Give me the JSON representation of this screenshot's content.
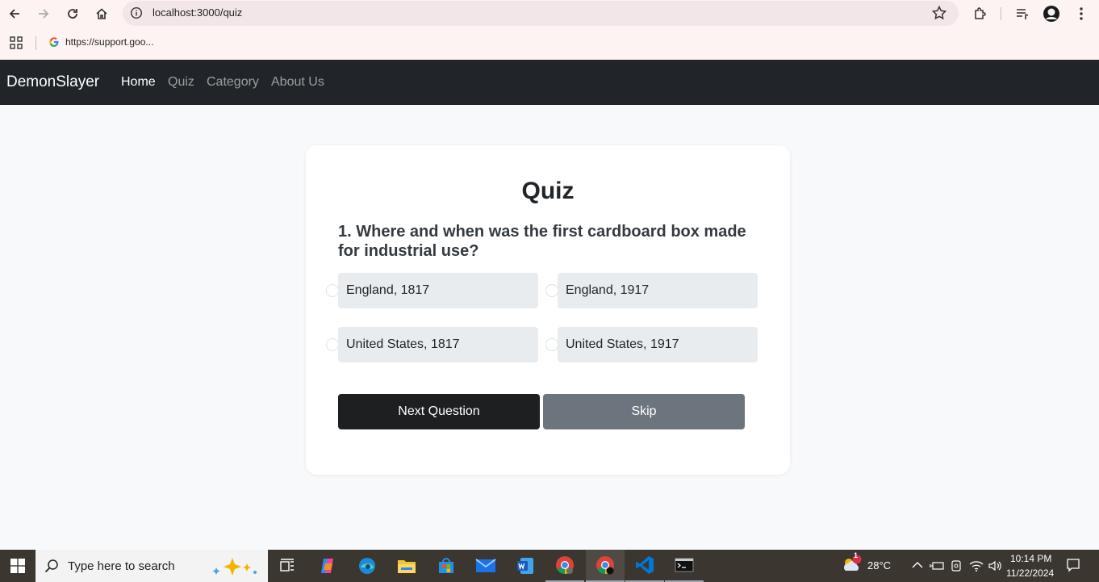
{
  "browser": {
    "url": "localhost:3000/quiz",
    "bookmark_label": "https://support.goo..."
  },
  "navbar": {
    "brand": "DemonSlayer",
    "links": [
      {
        "label": "Home",
        "active": true
      },
      {
        "label": "Quiz",
        "active": false
      },
      {
        "label": "Category",
        "active": false
      },
      {
        "label": "About Us",
        "active": false
      }
    ]
  },
  "quiz": {
    "title": "Quiz",
    "question": "1. Where and when was the first cardboard box made for industrial use?",
    "options": [
      "England, 1817",
      "England, 1917",
      "United States, 1817",
      "United States, 1917"
    ],
    "next_label": "Next Question",
    "skip_label": "Skip"
  },
  "taskbar": {
    "search_placeholder": "Type here to search",
    "apps": [
      "task-view",
      "copilot",
      "edge",
      "file-explorer",
      "microsoft-store",
      "mail",
      "word",
      "chrome",
      "chrome",
      "vscode",
      "terminal"
    ],
    "weather_temp": "28°C",
    "weather_badge": "1",
    "time": "10:14 PM",
    "date": "11/22/2024"
  },
  "colors": {
    "navbar_bg": "#212529",
    "page_bg": "#f8f9fa",
    "option_bg": "#e9ecef",
    "next_button": "#1d1f20",
    "skip_button": "#6c757d"
  }
}
